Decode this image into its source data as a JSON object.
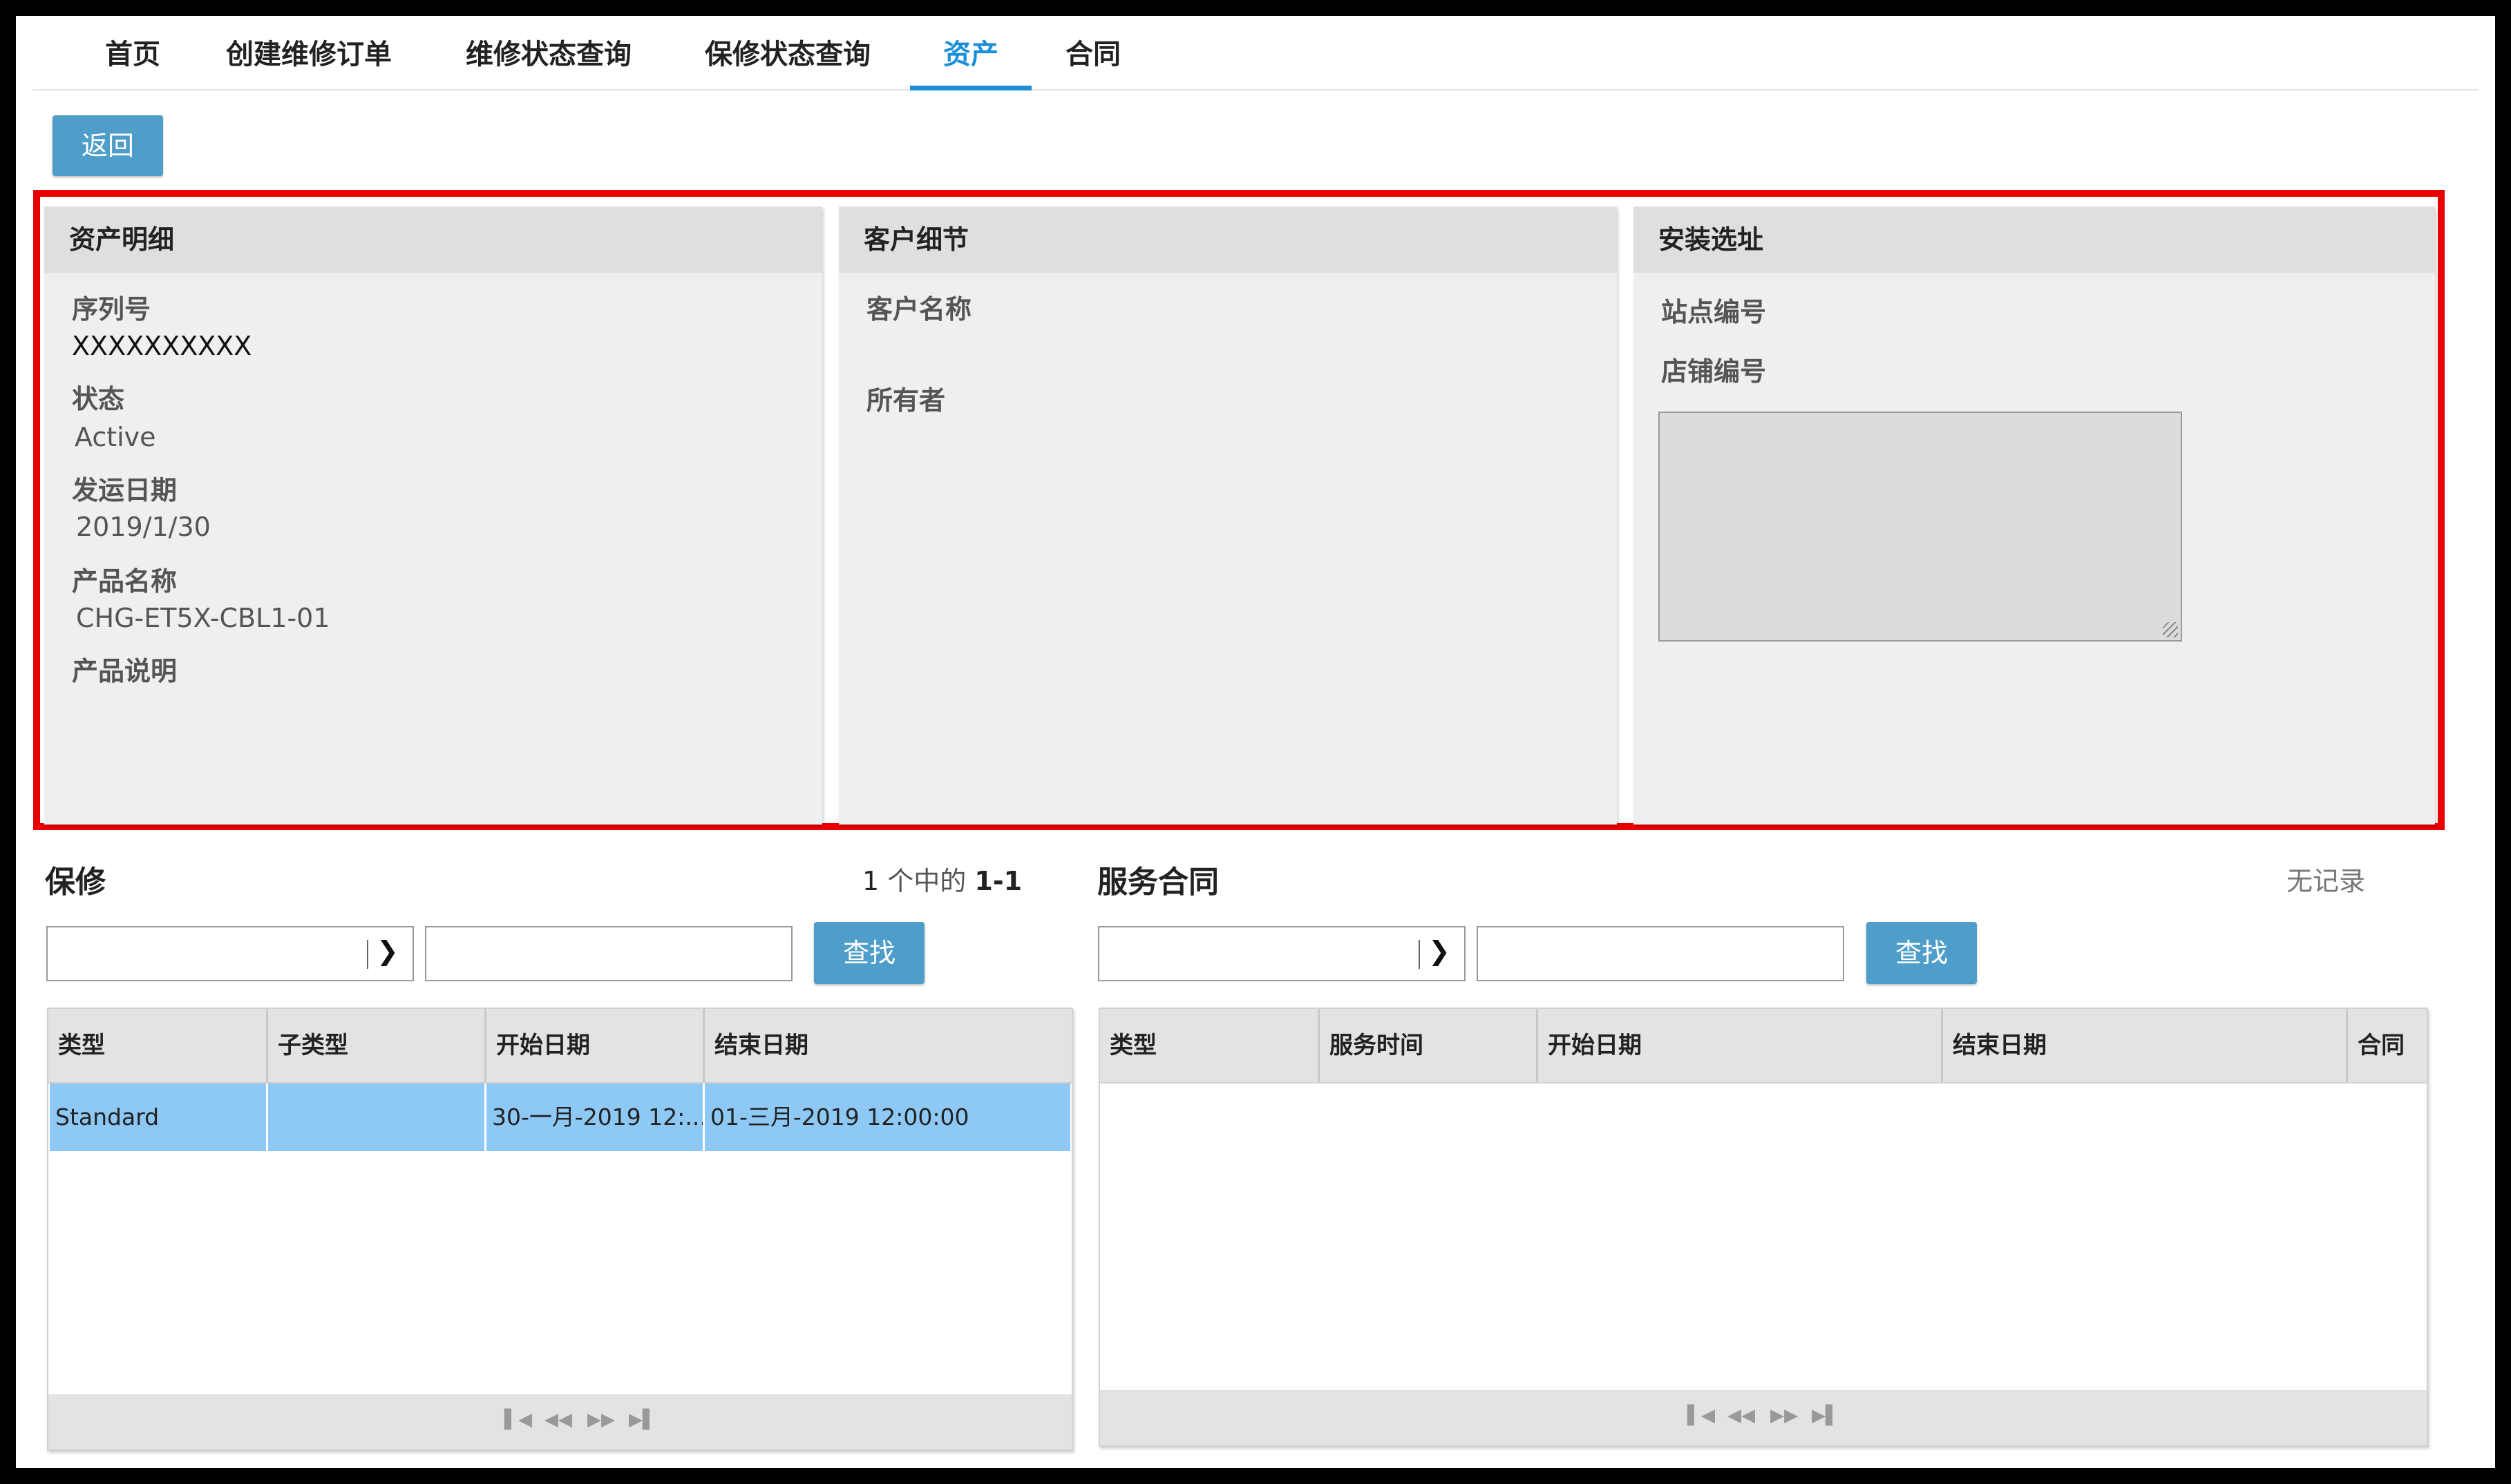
{
  "nav": {
    "tabs": [
      {
        "label": "首页",
        "active": false
      },
      {
        "label": "创建维修订单",
        "active": false
      },
      {
        "label": "维修状态查询",
        "active": false
      },
      {
        "label": "保修状态查询",
        "active": false
      },
      {
        "label": "资产",
        "active": true
      },
      {
        "label": "合同",
        "active": false
      }
    ]
  },
  "toolbar": {
    "back_label": "返回"
  },
  "asset_details": {
    "title": "资产明细",
    "serial_label": "序列号",
    "serial_value": "XXXXXXXXXX",
    "status_label": "状态",
    "status_value": "Active",
    "ship_date_label": "发运日期",
    "ship_date_value": "2019/1/30",
    "product_name_label": "产品名称",
    "product_name_value": "CHG-ET5X-CBL1-01",
    "product_desc_label": "产品说明"
  },
  "customer_details": {
    "title": "客户细节",
    "customer_name_label": "客户名称",
    "owner_label": "所有者"
  },
  "install_address": {
    "title": "安装选址",
    "site_number_label": "站点编号",
    "store_number_label": "店铺编号"
  },
  "warranty": {
    "title": "保修",
    "count_prefix": "1",
    "count_mid": "个中的",
    "count_range": "1-1",
    "search_label": "查找",
    "columns": [
      "类型",
      "子类型",
      "开始日期",
      "结束日期"
    ],
    "rows": [
      {
        "type": "Standard",
        "subtype": "",
        "start": "30-一月-2019 12:...",
        "end": "01-三月-2019 12:00:00"
      }
    ]
  },
  "service_contract": {
    "title": "服务合同",
    "count_text": "无记录",
    "search_label": "查找",
    "columns": [
      "类型",
      "服务时间",
      "开始日期",
      "结束日期",
      "合同"
    ]
  },
  "colors": {
    "accent": "#1a8fd8",
    "button": "#4f9ec9",
    "highlight_border": "#e80000",
    "selected_row": "#8ec8f5"
  }
}
